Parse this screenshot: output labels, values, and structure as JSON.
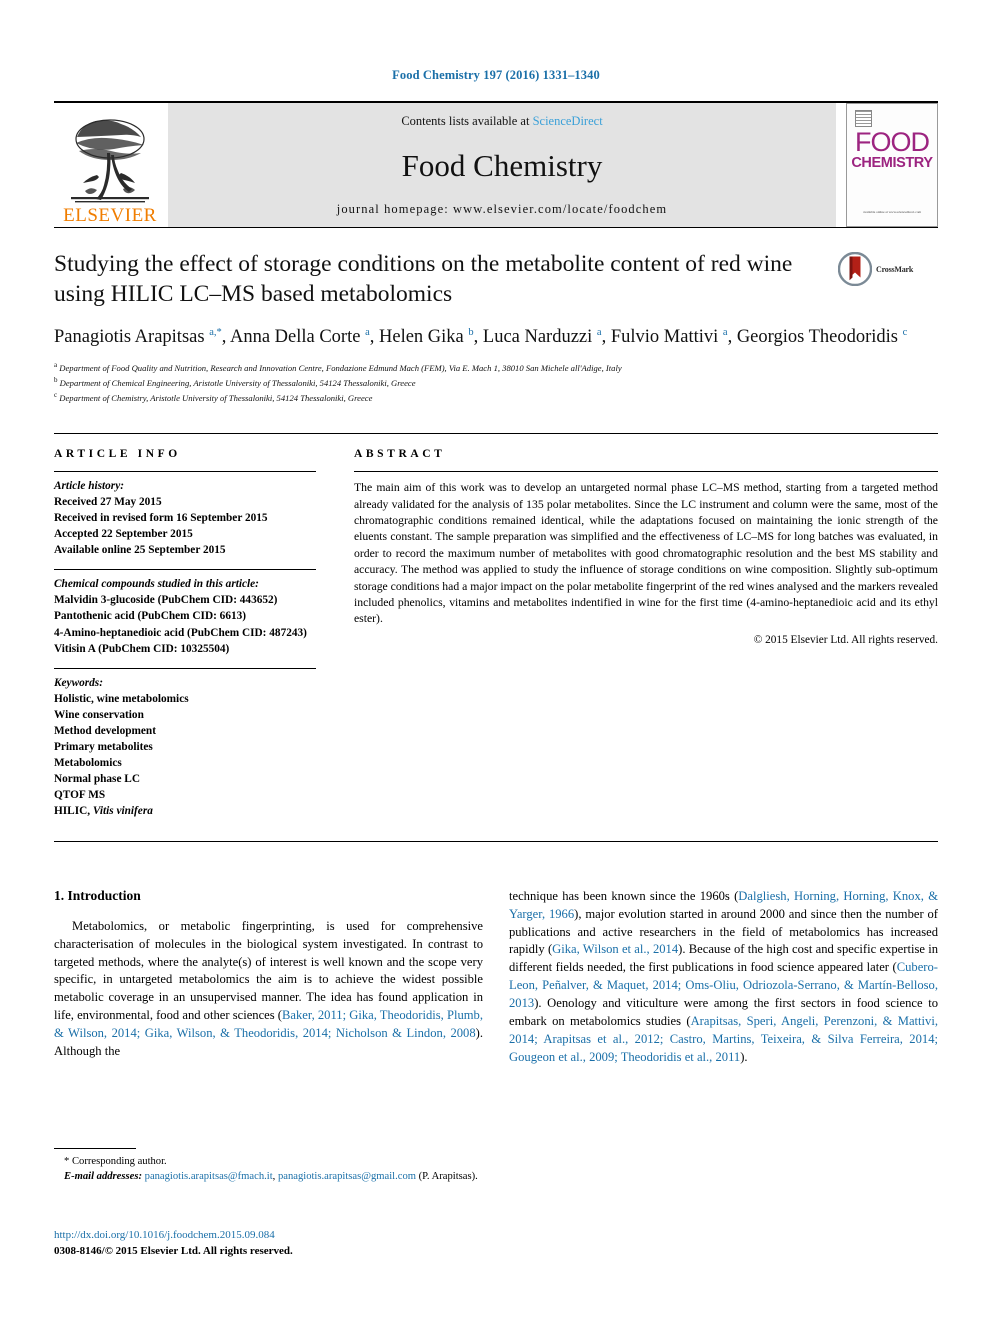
{
  "running_head": "Food Chemistry 197 (2016) 1331–1340",
  "masthead": {
    "publisher_name": "ELSEVIER",
    "contents_prefix": "Contents lists available at ",
    "contents_link": "ScienceDirect",
    "journal_title": "Food Chemistry",
    "homepage": "journal homepage: www.elsevier.com/locate/foodchem",
    "cover": {
      "line1": "FOOD",
      "line2": "CHEMISTRY",
      "footer": "available online at www.sciencedirect.com"
    }
  },
  "title": "Studying the effect of storage conditions on the metabolite content of red wine using HILIC LC–MS based metabolomics",
  "crossmark_label": "CrossMark",
  "authors_html": "Panagiotis Arapitsas <sup>a,*</sup>, Anna Della Corte <sup>a</sup>, Helen Gika <sup>b</sup>, Luca Narduzzi <sup>a</sup>, Fulvio Mattivi <sup>a</sup>, Georgios Theodoridis <sup>c</sup>",
  "affiliations": [
    {
      "marker": "a",
      "text": "Department of Food Quality and Nutrition, Research and Innovation Centre, Fondazione Edmund Mach (FEM), Via E. Mach 1, 38010 San Michele all'Adige, Italy"
    },
    {
      "marker": "b",
      "text": "Department of Chemical Engineering, Aristotle University of Thessaloniki, 54124 Thessaloniki, Greece"
    },
    {
      "marker": "c",
      "text": "Department of Chemistry, Aristotle University of Thessaloniki, 54124 Thessaloniki, Greece"
    }
  ],
  "article_info": {
    "heading": "ARTICLE INFO",
    "history_label": "Article history:",
    "history": [
      "Received 27 May 2015",
      "Received in revised form 16 September 2015",
      "Accepted 22 September 2015",
      "Available online 25 September 2015"
    ],
    "compounds_label": "Chemical compounds studied in this article:",
    "compounds": [
      "Malvidin 3-glucoside (PubChem CID: 443652)",
      "Pantothenic acid (PubChem CID: 6613)",
      "4-Amino-heptanedioic acid (PubChem CID: 487243)",
      "Vitisin A (PubChem CID: 10325504)"
    ],
    "keywords_label": "Keywords:",
    "keywords": [
      "Holistic, wine metabolomics",
      "Wine conservation",
      "Method development",
      "Primary metabolites",
      "Metabolomics",
      "Normal phase LC",
      "QTOF MS",
      "HILIC, Vitis vinifera"
    ]
  },
  "abstract": {
    "heading": "ABSTRACT",
    "text": "The main aim of this work was to develop an untargeted normal phase LC–MS method, starting from a targeted method already validated for the analysis of 135 polar metabolites. Since the LC instrument and column were the same, most of the chromatographic conditions remained identical, while the adaptations focused on maintaining the ionic strength of the eluents constant. The sample preparation was simplified and the effectiveness of LC–MS for long batches was evaluated, in order to record the maximum number of metabolites with good chromatographic resolution and the best MS stability and accuracy. The method was applied to study the influence of storage conditions on wine composition. Slightly sub-optimum storage conditions had a major impact on the polar metabolite fingerprint of the red wines analysed and the markers revealed included phenolics, vitamins and metabolites indentified in wine for the first time (4-amino-heptanedioic acid and its ethyl ester).",
    "copyright": "© 2015 Elsevier Ltd. All rights reserved."
  },
  "introduction": {
    "heading": "1. Introduction",
    "left_paragraph_pre": "Metabolomics, or metabolic fingerprinting, is used for comprehensive characterisation of molecules in the biological system investigated. In contrast to targeted methods, where the analyte(s) of interest is well known and the scope very specific, in untargeted metabolomics the aim is to achieve the widest possible metabolic coverage in an unsupervised manner. The idea has found application in life, environmental, food and other sciences (",
    "left_citation": "Baker, 2011; Gika, Theodoridis, Plumb, & Wilson, 2014; Gika, Wilson, & Theodoridis, 2014; Nicholson & Lindon, 2008",
    "left_paragraph_post": "). Although the",
    "right_pre_1": "technique has been known since the 1960s (",
    "right_cite_1": "Dalgliesh, Horning, Horning, Knox, & Yarger, 1966",
    "right_mid_1": "), major evolution started in around 2000 and since then the number of publications and active researchers in the field of metabolomics has increased rapidly (",
    "right_cite_2": "Gika, Wilson et al., 2014",
    "right_mid_2": "). Because of the high cost and specific expertise in different fields needed, the first publications in food science appeared later (",
    "right_cite_3": "Cubero-Leon, Peñalver, & Maquet, 2014; Oms-Oliu, Odriozola-Serrano, & Martín-Belloso, 2013",
    "right_mid_3": "). Oenology and viticulture were among the first sectors in food science to embark on metabolomics studies (",
    "right_cite_4": "Arapitsas, Speri, Angeli, Perenzoni, & Mattivi, 2014; Arapitsas et al., 2012; Castro, Martins, Teixeira, & Silva Ferreira, 2014; Gougeon et al., 2009; Theodoridis et al., 2011",
    "right_post": ")."
  },
  "footnote": {
    "corresponding": "Corresponding author.",
    "email_label": "E-mail addresses:",
    "email1": "panagiotis.arapitsas@fmach.it",
    "email_sep": ", ",
    "email2": "panagiotis.arapitsas@gmail.com",
    "email_suffix": " (P. Arapitsas)."
  },
  "doi": {
    "url": "http://dx.doi.org/10.1016/j.foodchem.2015.09.084",
    "issn_line": "0308-8146/© 2015 Elsevier Ltd. All rights reserved."
  },
  "colors": {
    "link": "#1a6fa8",
    "elsevier_orange": "#f07d00",
    "cover_magenta": "#9c2480",
    "masthead_grey": "#e3e3e3"
  }
}
